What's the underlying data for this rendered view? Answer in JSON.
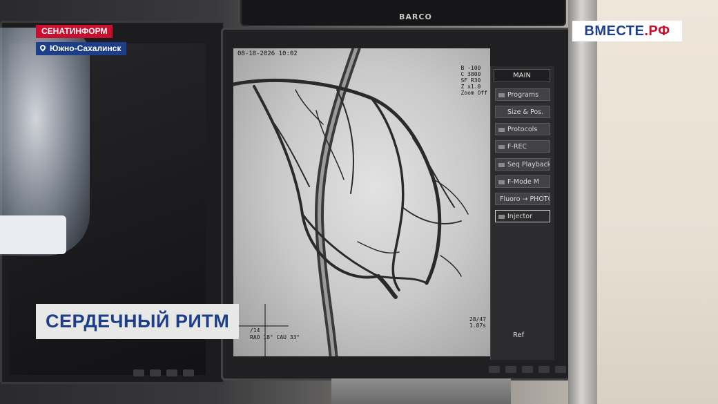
{
  "broadcast": {
    "source": "СЕНАТИНФОРМ",
    "location": "Южно-Сахалинск",
    "channel": "ВМЕСТЕ",
    "channel_suffix": ".РФ",
    "headline": "СЕРДЕЧНЫЙ РИТМ"
  },
  "top_monitor": {
    "brand": "BARCO"
  },
  "angio_screen": {
    "datetime": "08-18-2026 10:02",
    "params": [
      "B -100",
      "C 3800",
      "SF R30",
      "Z x1.0",
      "Zoom Off"
    ],
    "frame_info": [
      "/14",
      "RAO 18°  CAU 33°"
    ],
    "frame_info_right": [
      "28/47",
      "1.87s"
    ],
    "menu": {
      "title": "MAIN",
      "items": [
        "Programs",
        "Size & Pos.",
        "Protocols",
        "F-REC",
        "Seq Playback",
        "F-Mode   M",
        "Fluoro → PHOTO",
        "Injector"
      ],
      "selected": "Injector",
      "ref_label": "Ref"
    }
  },
  "colors": {
    "red": "#c8102e",
    "blue": "#1d3f8a",
    "headline_bg": "#e8e8e6"
  }
}
